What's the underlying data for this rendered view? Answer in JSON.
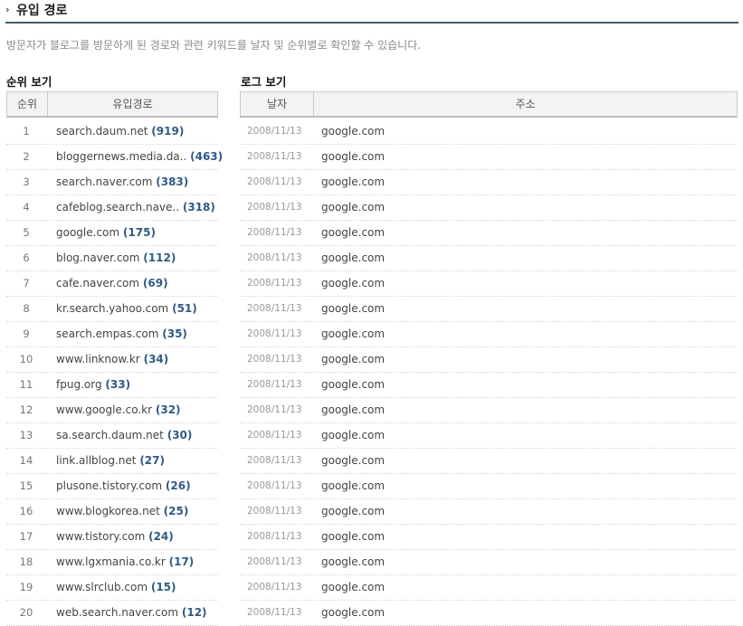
{
  "header": {
    "title": "유입 경로",
    "description": "방문자가 블로그를 방문하게 된 경로와 관련 키워드를 날자 및 순위별로 확인할 수 있습니다."
  },
  "rank_view": {
    "label": "순위 보기",
    "columns": [
      "순위",
      "유입경로"
    ],
    "rows": [
      {
        "rank": "1",
        "site": "search.daum.net",
        "count": "(919)"
      },
      {
        "rank": "2",
        "site": "bloggernews.media.da..",
        "count": "(463)"
      },
      {
        "rank": "3",
        "site": "search.naver.com",
        "count": "(383)"
      },
      {
        "rank": "4",
        "site": "cafeblog.search.nave..",
        "count": "(318)"
      },
      {
        "rank": "5",
        "site": "google.com",
        "count": "(175)"
      },
      {
        "rank": "6",
        "site": "blog.naver.com",
        "count": "(112)"
      },
      {
        "rank": "7",
        "site": "cafe.naver.com",
        "count": "(69)"
      },
      {
        "rank": "8",
        "site": "kr.search.yahoo.com",
        "count": "(51)"
      },
      {
        "rank": "9",
        "site": "search.empas.com",
        "count": "(35)"
      },
      {
        "rank": "10",
        "site": "www.linknow.kr",
        "count": "(34)"
      },
      {
        "rank": "11",
        "site": "fpug.org",
        "count": "(33)"
      },
      {
        "rank": "12",
        "site": "www.google.co.kr",
        "count": "(32)"
      },
      {
        "rank": "13",
        "site": "sa.search.daum.net",
        "count": "(30)"
      },
      {
        "rank": "14",
        "site": "link.allblog.net",
        "count": "(27)"
      },
      {
        "rank": "15",
        "site": "plusone.tistory.com",
        "count": "(26)"
      },
      {
        "rank": "16",
        "site": "www.blogkorea.net",
        "count": "(25)"
      },
      {
        "rank": "17",
        "site": "www.tistory.com",
        "count": "(24)"
      },
      {
        "rank": "18",
        "site": "www.lgxmania.co.kr",
        "count": "(17)"
      },
      {
        "rank": "19",
        "site": "www.slrclub.com",
        "count": "(15)"
      },
      {
        "rank": "20",
        "site": "web.search.naver.com",
        "count": "(12)"
      }
    ]
  },
  "log_view": {
    "label": "로그 보기",
    "columns": [
      "날자",
      "주소"
    ],
    "rows": [
      {
        "date": "2008/11/13",
        "address": "google.com"
      },
      {
        "date": "2008/11/13",
        "address": "google.com"
      },
      {
        "date": "2008/11/13",
        "address": "google.com"
      },
      {
        "date": "2008/11/13",
        "address": "google.com"
      },
      {
        "date": "2008/11/13",
        "address": "google.com"
      },
      {
        "date": "2008/11/13",
        "address": "google.com"
      },
      {
        "date": "2008/11/13",
        "address": "google.com"
      },
      {
        "date": "2008/11/13",
        "address": "google.com"
      },
      {
        "date": "2008/11/13",
        "address": "google.com"
      },
      {
        "date": "2008/11/13",
        "address": "google.com"
      },
      {
        "date": "2008/11/13",
        "address": "google.com"
      },
      {
        "date": "2008/11/13",
        "address": "google.com"
      },
      {
        "date": "2008/11/13",
        "address": "google.com"
      },
      {
        "date": "2008/11/13",
        "address": "google.com"
      },
      {
        "date": "2008/11/13",
        "address": "google.com"
      },
      {
        "date": "2008/11/13",
        "address": "google.com"
      },
      {
        "date": "2008/11/13",
        "address": "google.com"
      },
      {
        "date": "2008/11/13",
        "address": "google.com"
      },
      {
        "date": "2008/11/13",
        "address": "google.com"
      },
      {
        "date": "2008/11/13",
        "address": "google.com"
      }
    ]
  },
  "colors": {
    "title_rule": "#4b5866",
    "count_text": "#2f5a86",
    "header_bg": "#f3f3f3"
  }
}
